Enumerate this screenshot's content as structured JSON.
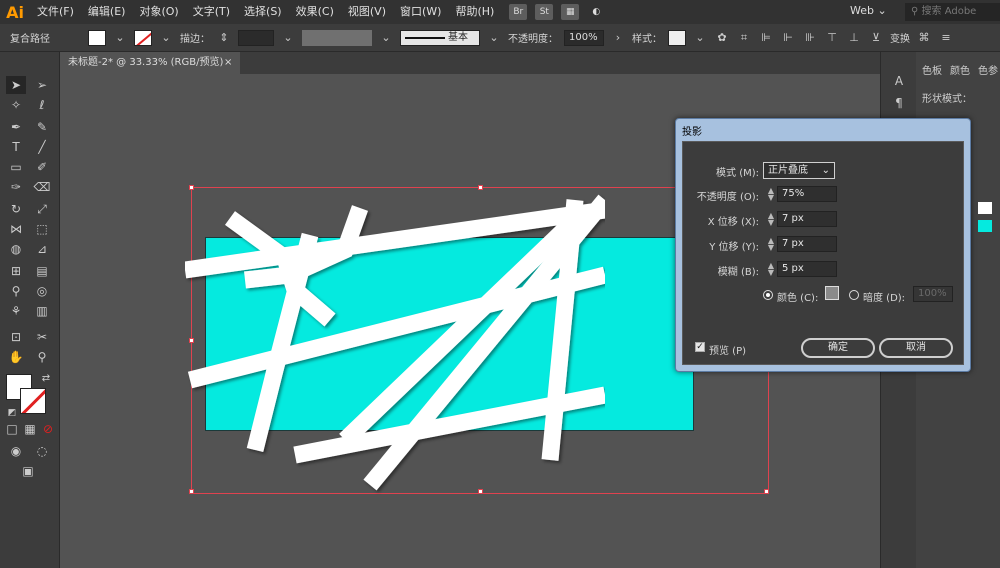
{
  "menubar": {
    "logo": "Ai",
    "items": [
      "文件(F)",
      "编辑(E)",
      "对象(O)",
      "文字(T)",
      "选择(S)",
      "效果(C)",
      "视图(V)",
      "窗口(W)",
      "帮助(H)"
    ],
    "icon_br": "Br",
    "icon_st": "St",
    "workspace": "Web",
    "search_placeholder": "搜索 Adobe Stock"
  },
  "controlbar": {
    "object_type": "复合路径",
    "stroke_label": "描边：",
    "stroke_style": "基本",
    "opacity_label": "不透明度：",
    "opacity_value": "100%",
    "style_label": "样式：",
    "transform_label": "变换"
  },
  "document": {
    "tab_title": "未标题-2* @ 33.33% (RGB/预览)",
    "close_glyph": "×"
  },
  "right_panel": {
    "tabs": [
      "色板",
      "颜色",
      "色参"
    ],
    "shape_modes": "形状模式："
  },
  "dialog": {
    "title": "投影",
    "mode_label": "模式 (M):",
    "mode_value": "正片叠底",
    "opacity_label": "不透明度 (O):",
    "opacity_value": "75%",
    "x_label": "X 位移 (X):",
    "x_value": "7 px",
    "y_label": "Y 位移 (Y):",
    "y_value": "7 px",
    "blur_label": "模糊 (B):",
    "blur_value": "5 px",
    "color_label": "颜色 (C):",
    "darkness_label": "暗度 (D):",
    "darkness_value": "100%",
    "preview_label": "预览 (P)",
    "ok_label": "确定",
    "cancel_label": "取消"
  },
  "colors": {
    "artwork_fill": "#05eadf",
    "selection": "#e0424f",
    "logo": "#ff9a00"
  }
}
